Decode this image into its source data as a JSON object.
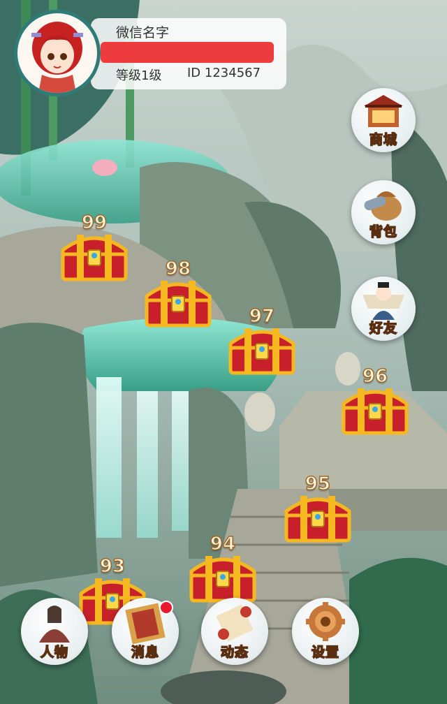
{
  "profile": {
    "name": "微信名字",
    "level": "等级1级",
    "id": "ID 1234567",
    "avatar_icon": "red-haired-girl-avatar-icon"
  },
  "chests": [
    {
      "number": "99"
    },
    {
      "number": "98"
    },
    {
      "number": "97"
    },
    {
      "number": "96"
    },
    {
      "number": "95"
    },
    {
      "number": "94"
    },
    {
      "number": "93"
    }
  ],
  "side_menu": [
    {
      "label": "商城",
      "icon": "shop-icon"
    },
    {
      "label": "背包",
      "icon": "backpack-icon"
    },
    {
      "label": "好友",
      "icon": "friends-icon"
    }
  ],
  "bottom_menu": [
    {
      "label": "人物",
      "icon": "character-icon"
    },
    {
      "label": "消息",
      "icon": "message-scroll-icon",
      "badge": true
    },
    {
      "label": "动态",
      "icon": "news-scroll-icon"
    },
    {
      "label": "设置",
      "icon": "gear-icon"
    }
  ],
  "colors": {
    "hp_bar": "#ee3b3d",
    "avatar_ring": "#2e7b78",
    "notification_dot": "#e8192c",
    "chest_red": "#c8202a",
    "chest_gold": "#f5b820"
  }
}
